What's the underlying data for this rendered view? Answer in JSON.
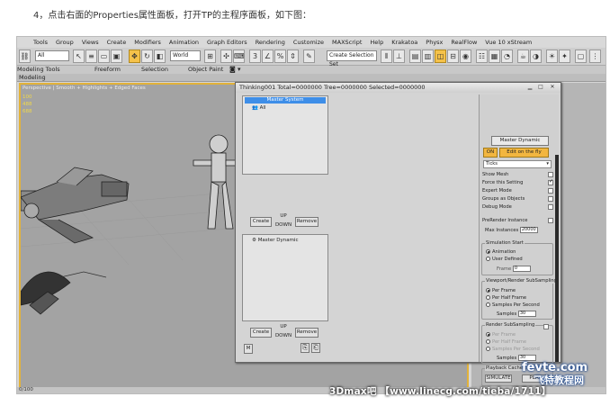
{
  "instruction": "4，点击右面的Properties属性面板，打开TP的主程序面板，如下图：",
  "menu": [
    "Tools",
    "Group",
    "Views",
    "Create",
    "Modifiers",
    "Animation",
    "Graph Editors",
    "Rendering",
    "Customize",
    "MAXScript",
    "Help",
    "Krakatoa",
    "Physx",
    "RealFlow",
    "Vue 10 xStream"
  ],
  "toolbar": {
    "filter_value": "All",
    "coord_value": "World",
    "selection_set": "Create Selection Set"
  },
  "ribbon_tabs": [
    "Modeling Tools",
    "Freeform",
    "Selection",
    "Object Paint"
  ],
  "modeling_label": "Modeling",
  "viewport": {
    "label": "Perspective | Smooth + Highlights + Edged Faces",
    "numbers": [
      "100",
      "488",
      "688"
    ]
  },
  "status_text": "0/100",
  "dialog": {
    "title": "Thinking001  Total=0000000  Tree=0000000  Selected=0000000",
    "top_list": {
      "header": "Master System",
      "item": "All"
    },
    "bottom_list": {
      "item": "Master Dynamic"
    },
    "buttons": {
      "create": "Create",
      "up": "UP",
      "down": "DOWN",
      "remove": "Remove",
      "m": "M"
    },
    "right_panel": {
      "header": "Master Dynamic",
      "on_label": "ON",
      "edit_label": "Edit on the fly",
      "ticks_value": "Ticks",
      "options": [
        {
          "label": "Show Mesh",
          "checked": false
        },
        {
          "label": "Force this Setting",
          "checked": true
        },
        {
          "label": "Expert Mode",
          "checked": false
        },
        {
          "label": "Groups as Objects",
          "checked": false
        },
        {
          "label": "Debug Mode",
          "checked": false
        }
      ],
      "prerender_label": "PreRender Instance",
      "max_instances_label": "Max Instances",
      "max_instances_value": "20000",
      "sim_start": {
        "title": "Simulation Start",
        "animation": "Animation",
        "user_defined": "User Defined",
        "frame_label": "Frame",
        "frame_value": "0"
      },
      "viewport_sub": {
        "title": "Viewport/Render SubSampling",
        "per_frame": "Per Frame",
        "per_half": "Per Half Frame",
        "samples_per_second": "Samples Per Second",
        "samples_label": "Samples",
        "samples_value": "30"
      },
      "render_sub": {
        "title": "Render SubSampling",
        "per_frame": "Per Frame",
        "per_half": "Per Half Frame",
        "samples_per_second": "Samples Per Second",
        "samples_label": "Samples",
        "samples_value": "30"
      },
      "playback": {
        "title": "Playback Cache",
        "simulate": "SIMULATE",
        "play": "PLAY"
      }
    }
  },
  "watermark": "3Dmax吧 【www.linecg.com/tieba/1711】",
  "logo_top": "fevte.com",
  "logo_bottom": "飞特教程网"
}
